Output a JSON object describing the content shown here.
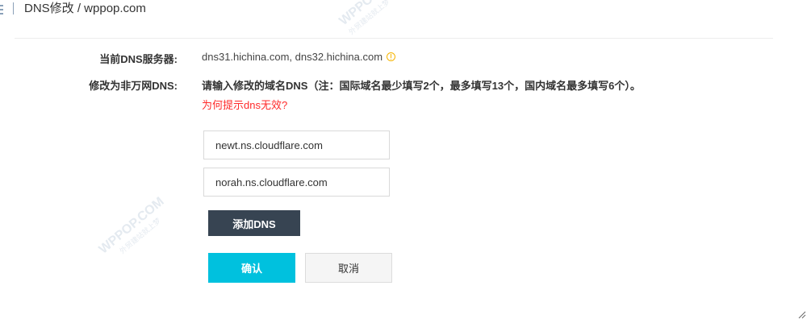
{
  "header": {
    "title": "DNS修改 / wppop.com"
  },
  "form": {
    "current_dns_label": "当前DNS服务器:",
    "current_dns_value": "dns31.hichina.com, dns32.hichina.com",
    "modify_label": "修改为非万网DNS:",
    "instruction": "请输入修改的域名DNS（注：国际域名最少填写2个，最多填写13个，国内域名最多填写6个）。",
    "help_link": "为何提示dns无效?",
    "dns_inputs": [
      {
        "value": "newt.ns.cloudflare.com"
      },
      {
        "value": "norah.ns.cloudflare.com"
      }
    ],
    "add_dns_label": "添加DNS",
    "confirm_label": "确认",
    "cancel_label": "取消"
  },
  "watermark": {
    "brand": "WPPOP.COM",
    "tagline": "外贸建站就上梦"
  },
  "colors": {
    "accent": "#00c1de",
    "add_button": "#374452",
    "link_red": "#ff2a2a",
    "info_icon": "#f5b400"
  }
}
